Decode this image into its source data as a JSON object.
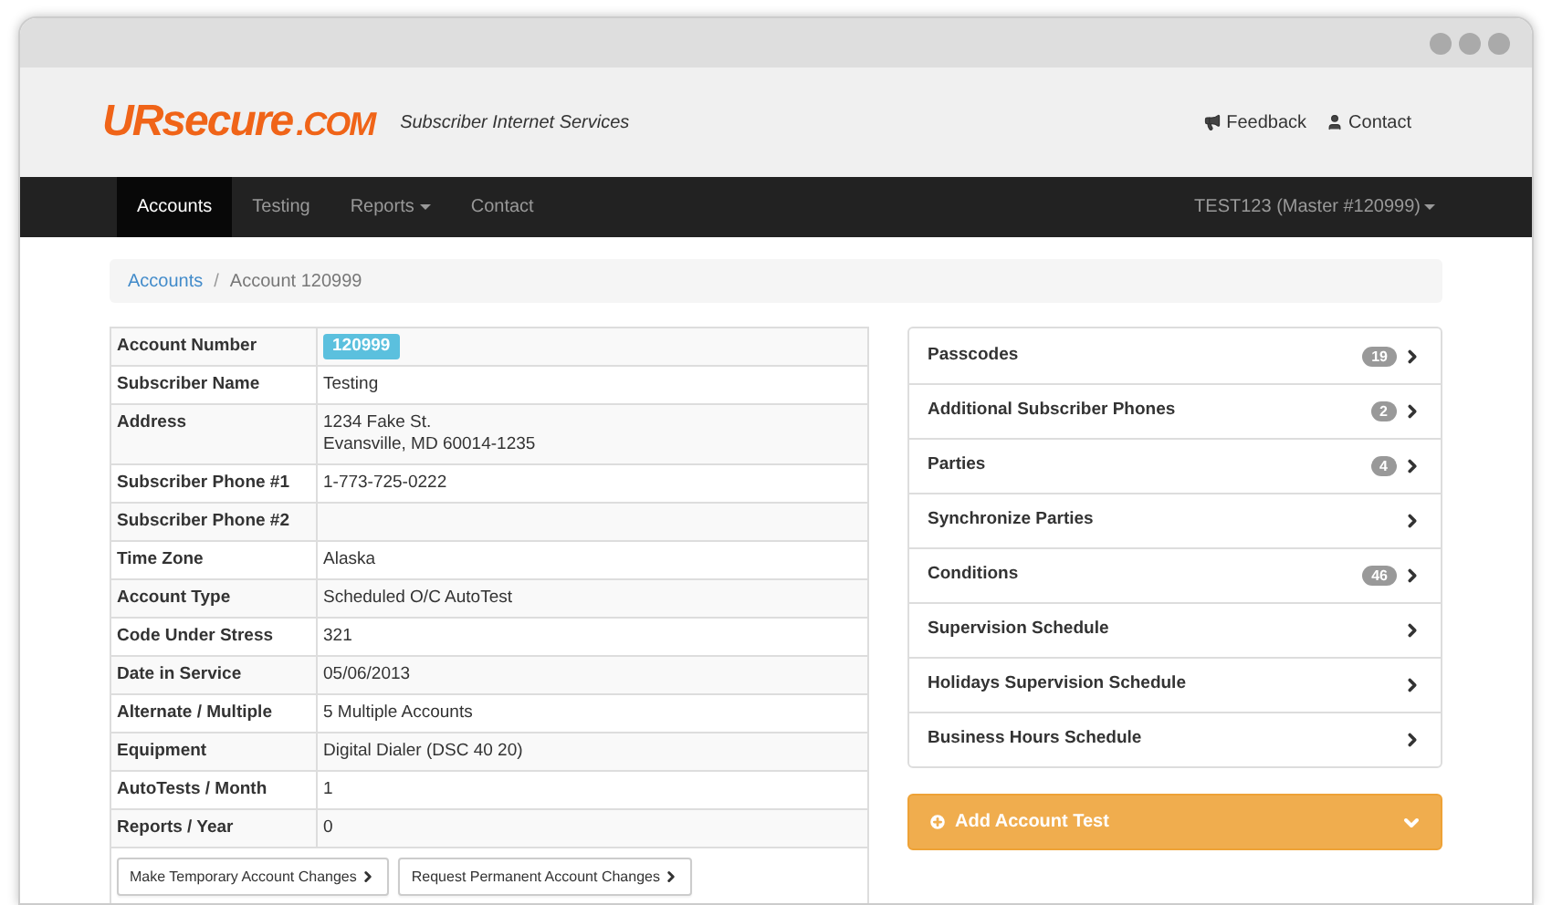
{
  "logo": {
    "main": "URsecure",
    "suffix": ".COM"
  },
  "tagline": "Subscriber Internet Services",
  "header_links": [
    {
      "kind": "feedback",
      "label": "Feedback"
    },
    {
      "kind": "contact",
      "label": "Contact"
    }
  ],
  "nav": [
    {
      "label": "Accounts",
      "selected": true,
      "dropdown": false
    },
    {
      "label": "Testing",
      "selected": false,
      "dropdown": false
    },
    {
      "label": "Reports",
      "selected": false,
      "dropdown": true
    },
    {
      "label": "Contact",
      "selected": false,
      "dropdown": false
    }
  ],
  "user_menu": "TEST123 (Master #120999)",
  "breadcrumb": [
    {
      "label": "Accounts",
      "link": true
    },
    {
      "label": "Account 120999",
      "link": false
    }
  ],
  "separator": "/",
  "details": [
    {
      "label": "Account Number",
      "value": [
        "120999"
      ],
      "kind": "badge"
    },
    {
      "label": "Subscriber Name",
      "value": [
        "Testing"
      ],
      "kind": "text"
    },
    {
      "label": "Address",
      "value": [
        "1234 Fake St.",
        "Evansville, MD 60014-1235"
      ],
      "kind": "text"
    },
    {
      "label": "Subscriber Phone #1",
      "value": [
        "1-773-725-0222"
      ],
      "kind": "text"
    },
    {
      "label": "Subscriber Phone #2",
      "kind": "text"
    },
    {
      "label": "Time Zone",
      "value": [
        "Alaska"
      ],
      "kind": "text"
    },
    {
      "label": "Account Type",
      "value": [
        "Scheduled O/C AutoTest"
      ],
      "kind": "text"
    },
    {
      "label": "Code Under Stress",
      "value": [
        "321"
      ],
      "kind": "text"
    },
    {
      "label": "Date in Service",
      "value": [
        "05/06/2013"
      ],
      "kind": "text"
    },
    {
      "label": "Alternate / Multiple",
      "value": [
        "5 Multiple Accounts"
      ],
      "kind": "text"
    },
    {
      "label": "Equipment",
      "value": [
        "Digital Dialer (DSC 40 20)"
      ],
      "kind": "text"
    },
    {
      "label": "AutoTests / Month",
      "value": [
        "1"
      ],
      "kind": "text"
    },
    {
      "label": "Reports / Year",
      "value": [
        "0"
      ],
      "kind": "text"
    }
  ],
  "actions": [
    "Make Temporary Account Changes",
    "Request Permanent Account Changes"
  ],
  "menu": [
    {
      "label": "Passcodes",
      "count": "19"
    },
    {
      "label": "Additional Subscriber Phones",
      "count": "2"
    },
    {
      "label": "Parties",
      "count": "4"
    },
    {
      "label": "Synchronize Parties"
    },
    {
      "label": "Conditions",
      "count": "46"
    },
    {
      "label": "Supervision Schedule"
    },
    {
      "label": "Holidays Supervision Schedule"
    },
    {
      "label": "Business Hours Schedule"
    }
  ],
  "add_test": {
    "label": "Add Account Test",
    "expanded": false
  }
}
